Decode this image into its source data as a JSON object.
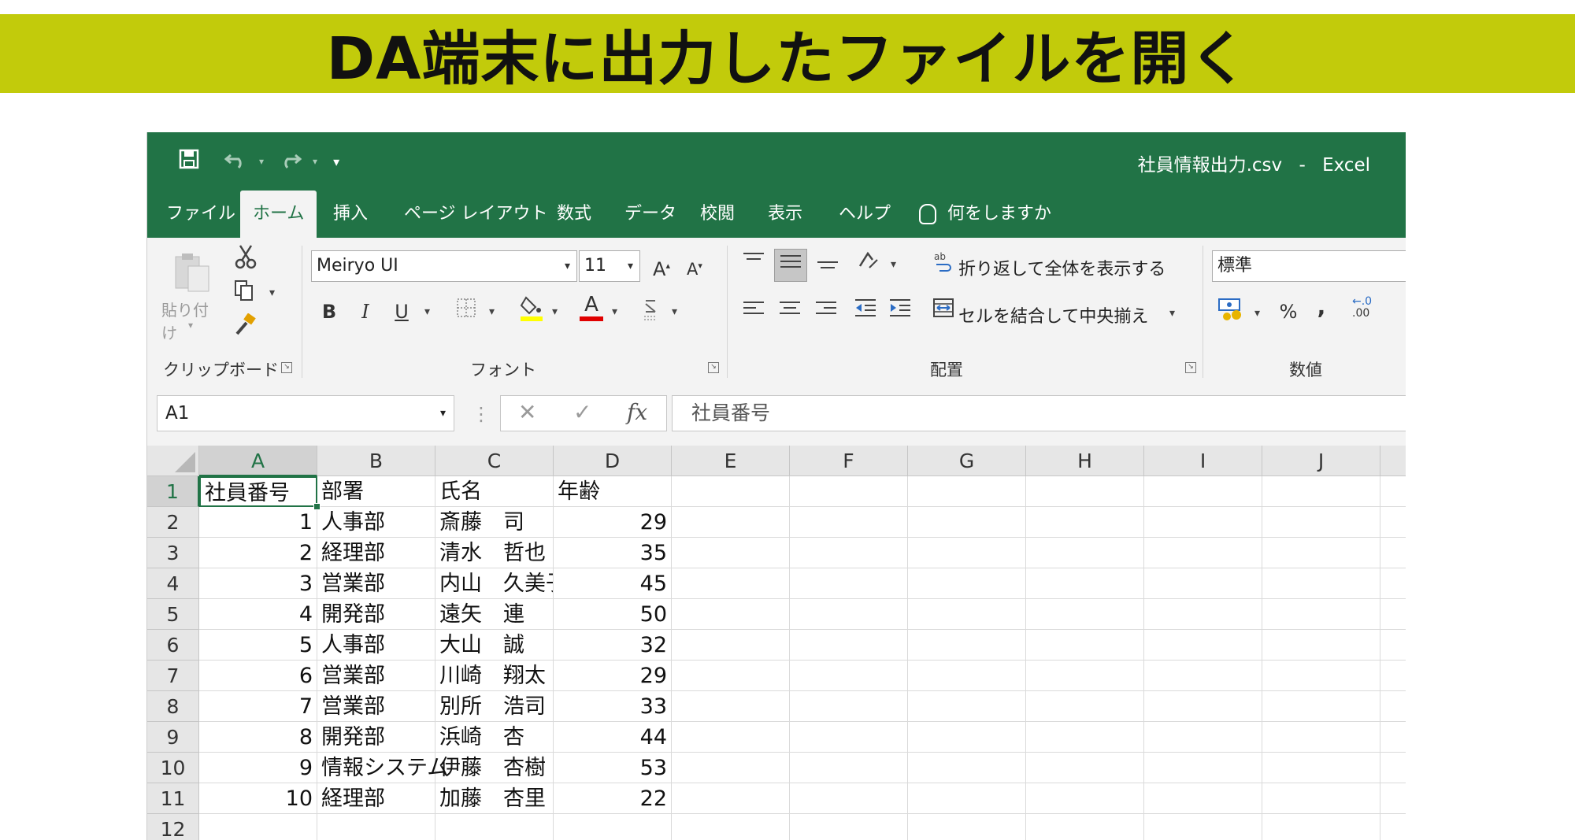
{
  "banner": {
    "title": "DA端末に出力したファイルを開く"
  },
  "window": {
    "file_name": "社員情報出力.csv",
    "separator": "-",
    "app_name": "Excel"
  },
  "quick_access": {
    "save_icon": "save-icon",
    "undo_icon": "undo-icon",
    "redo_icon": "redo-icon",
    "customize": "▾"
  },
  "tabs": [
    {
      "label": "ファイル"
    },
    {
      "label": "ホーム",
      "active": true
    },
    {
      "label": "挿入"
    },
    {
      "label": "ページ レイアウト"
    },
    {
      "label": "数式"
    },
    {
      "label": "データ"
    },
    {
      "label": "校閲"
    },
    {
      "label": "表示"
    },
    {
      "label": "ヘルプ"
    }
  ],
  "tell_me": "何をしますか",
  "ribbon": {
    "clipboard": {
      "paste_label": "貼り付け",
      "group_label": "クリップボード"
    },
    "font": {
      "font_name": "Meiryo UI",
      "font_size": "11",
      "bold": "B",
      "italic": "I",
      "underline": "U",
      "font_color_glyph": "A",
      "group_label": "フォント"
    },
    "alignment": {
      "wrap_text": "折り返して全体を表示する",
      "merge_center": "セルを結合して中央揃え",
      "group_label": "配置"
    },
    "number": {
      "format": "標準",
      "percent": "%",
      "comma": ",",
      "decimal": ".00",
      "group_label": "数値"
    }
  },
  "formula_bar": {
    "name_box": "A1",
    "cancel": "✕",
    "enter": "✓",
    "fx": "fx",
    "content": "社員番号"
  },
  "columns": [
    "A",
    "B",
    "C",
    "D",
    "E",
    "F",
    "G",
    "H",
    "I",
    "J"
  ],
  "selected_cell": {
    "column": "A",
    "row": "1"
  },
  "rows": [
    {
      "num": "1",
      "a": "社員番号",
      "b": "部署",
      "c": "氏名",
      "d": "年齢"
    },
    {
      "num": "2",
      "a": "1",
      "b": "人事部",
      "c": "斎藤　司",
      "d": "29"
    },
    {
      "num": "3",
      "a": "2",
      "b": "経理部",
      "c": "清水　哲也",
      "d": "35"
    },
    {
      "num": "4",
      "a": "3",
      "b": "営業部",
      "c": "内山　久美子",
      "d": "45"
    },
    {
      "num": "5",
      "a": "4",
      "b": "開発部",
      "c": "遠矢　連",
      "d": "50"
    },
    {
      "num": "6",
      "a": "5",
      "b": "人事部",
      "c": "大山　誠",
      "d": "32"
    },
    {
      "num": "7",
      "a": "6",
      "b": "営業部",
      "c": "川崎　翔太",
      "d": "29"
    },
    {
      "num": "8",
      "a": "7",
      "b": "営業部",
      "c": "別所　浩司",
      "d": "33"
    },
    {
      "num": "9",
      "a": "8",
      "b": "開発部",
      "c": "浜崎　杏",
      "d": "44"
    },
    {
      "num": "10",
      "a": "9",
      "b": "情報システム",
      "c": "伊藤　杏樹",
      "d": "53"
    },
    {
      "num": "11",
      "a": "10",
      "b": "経理部",
      "c": "加藤　杏里",
      "d": "22"
    },
    {
      "num": "12",
      "a": "",
      "b": "",
      "c": "",
      "d": ""
    }
  ],
  "colors": {
    "excel_green": "#217346",
    "banner": "#c2cb0b"
  }
}
